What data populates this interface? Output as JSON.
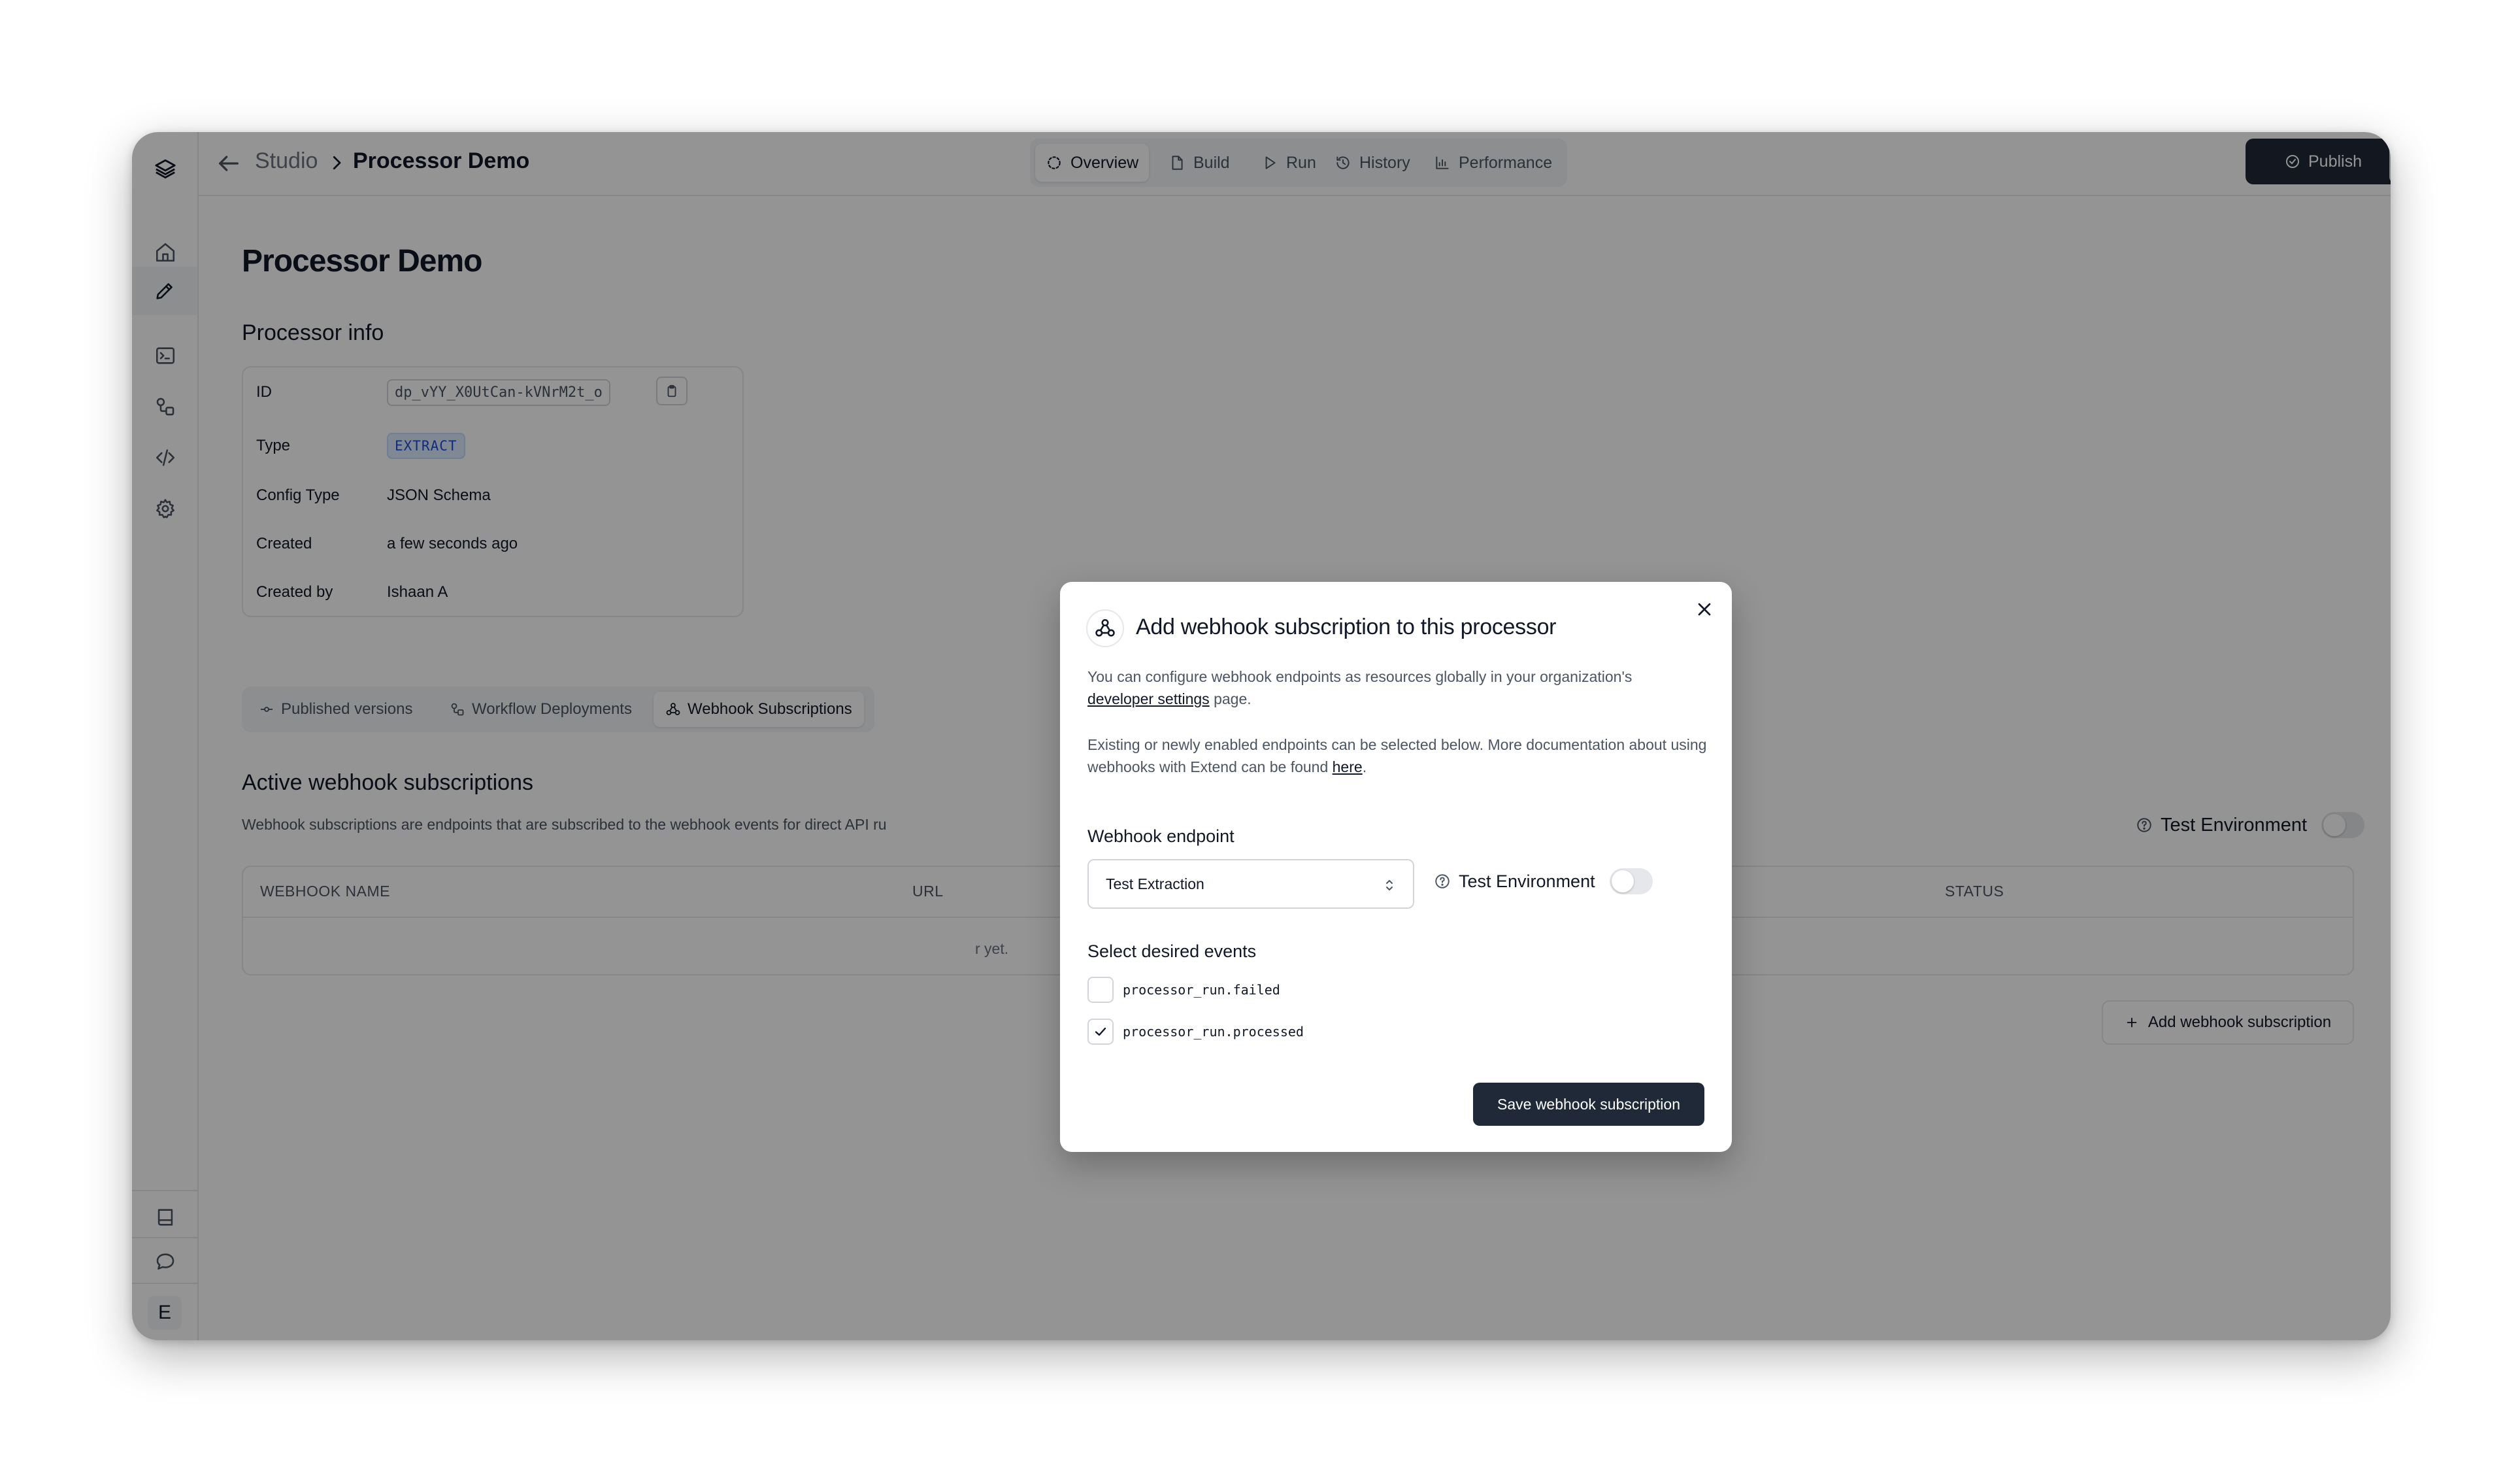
{
  "breadcrumb": {
    "root": "Studio",
    "current": "Processor Demo"
  },
  "top_tabs": [
    {
      "label": "Overview",
      "icon": "loader-icon",
      "active": true
    },
    {
      "label": "Build",
      "icon": "file-icon",
      "active": false
    },
    {
      "label": "Run",
      "icon": "play-icon",
      "active": false
    },
    {
      "label": "History",
      "icon": "history-icon",
      "active": false
    },
    {
      "label": "Performance",
      "icon": "bar-chart-icon",
      "active": false
    }
  ],
  "publish_label": "Publish",
  "page_title": "Processor Demo",
  "processor_info": {
    "heading": "Processor info",
    "rows": {
      "id": {
        "key": "ID",
        "value": "dp_vYY_X0UtCan-kVNrM2t_o"
      },
      "type": {
        "key": "Type",
        "value": "EXTRACT"
      },
      "config_type": {
        "key": "Config Type",
        "value": "JSON Schema"
      },
      "created": {
        "key": "Created",
        "value": "a few seconds ago"
      },
      "created_by": {
        "key": "Created by",
        "value": "Ishaan A"
      }
    }
  },
  "sub_tabs": [
    {
      "label": "Published versions",
      "icon": "git-commit-icon",
      "active": false
    },
    {
      "label": "Workflow Deployments",
      "icon": "workflow-icon",
      "active": false
    },
    {
      "label": "Webhook Subscriptions",
      "icon": "webhook-icon",
      "active": true
    }
  ],
  "webhooks_section": {
    "heading": "Active webhook subscriptions",
    "description": "Webhook subscriptions are endpoints that are subscribed to the webhook events for direct API ru",
    "test_env_label": "Test Environment",
    "test_env_enabled": false,
    "table_headers": {
      "name": "WEBHOOK NAME",
      "url": "URL",
      "status": "STATUS"
    },
    "empty_text": "r yet.",
    "add_button": "Add webhook subscription"
  },
  "modal": {
    "title": "Add webhook subscription to this processor",
    "para1_text": "You can configure webhook endpoints as resources globally in your organization's",
    "para1_link": "developer settings",
    "para1_tail": " page.",
    "para2_text": "Existing or newly enabled endpoints can be selected below. More documentation about using webhooks with Extend can be found ",
    "para2_link": "here",
    "para2_tail": ".",
    "endpoint_label": "Webhook endpoint",
    "endpoint_value": "Test Extraction",
    "test_env_label": "Test Environment",
    "test_env_enabled": false,
    "events_label": "Select desired events",
    "events": [
      {
        "label": "processor_run.failed",
        "checked": false
      },
      {
        "label": "processor_run.processed",
        "checked": true
      }
    ],
    "save_label": "Save webhook subscription"
  },
  "user_initial": "E"
}
